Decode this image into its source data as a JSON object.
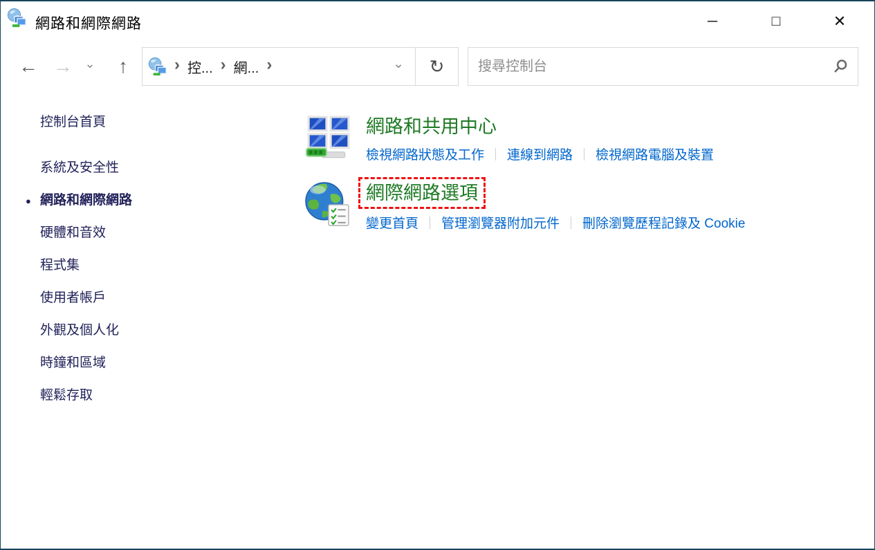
{
  "window": {
    "title": "網路和網際網路",
    "border_color": "#17455c"
  },
  "titlebar": {
    "app_icon": "network-internet-icon",
    "minimize_glyph": "─",
    "maximize_glyph": "□",
    "close_glyph": "✕"
  },
  "navbar": {
    "back_glyph": "←",
    "forward_glyph": "→",
    "history_dropdown_glyph": "⌄",
    "up_glyph": "↑",
    "breadcrumb": {
      "icon": "network-internet-icon",
      "chevron_glyph": "›",
      "items": [
        "控...",
        "網..."
      ],
      "dropdown_glyph": "⌄"
    },
    "refresh_glyph": "↻",
    "search": {
      "placeholder": "搜尋控制台",
      "icon": "magnifier-icon"
    }
  },
  "sidebar": {
    "active_bullet_glyph": "●",
    "items": [
      {
        "label": "控制台首頁",
        "active": false
      },
      {
        "label": "系統及安全性",
        "active": false
      },
      {
        "label": "網路和網際網路",
        "active": true
      },
      {
        "label": "硬體和音效",
        "active": false
      },
      {
        "label": "程式集",
        "active": false
      },
      {
        "label": "使用者帳戶",
        "active": false
      },
      {
        "label": "外觀及個人化",
        "active": false
      },
      {
        "label": "時鐘和區域",
        "active": false
      },
      {
        "label": "輕鬆存取",
        "active": false
      }
    ]
  },
  "main": {
    "sections": [
      {
        "icon": "network-sharing-center-icon",
        "title": "網路和共用中心",
        "highlighted": false,
        "links": [
          "檢視網路狀態及工作",
          "連線到網路",
          "檢視網路電腦及裝置"
        ]
      },
      {
        "icon": "internet-options-icon",
        "title": "網際網路選項",
        "highlighted": true,
        "links": [
          "變更首頁",
          "管理瀏覽器附加元件",
          "刪除瀏覽歷程記錄及 Cookie"
        ]
      }
    ]
  },
  "colors": {
    "window_border": "#17455c",
    "heading_green": "#1e7a24",
    "link_blue": "#0066cc",
    "sidebar_navy": "#21215a",
    "highlight_red": "#ee1111",
    "box_border_gray": "#d9d9d9"
  }
}
